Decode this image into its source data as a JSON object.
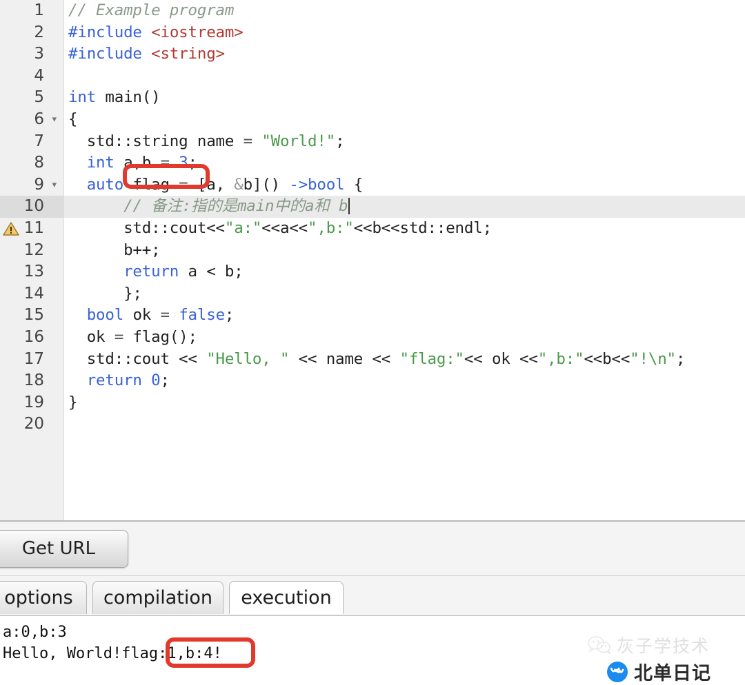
{
  "editor": {
    "active_line": 10,
    "warning_line": 11,
    "fold_lines": [
      6,
      9
    ],
    "caret_line": 10,
    "colors": {
      "comment": "#8a9a8a",
      "keyword": "#3a62d8",
      "include": "#b33a32",
      "string": "#4a9a4a",
      "gutter_bg": "#f0f0f0",
      "active_line_bg": "#eaeaea",
      "annotation_red": "#e1392c"
    },
    "lines": [
      {
        "n": "1",
        "tokens": [
          {
            "t": "// Example program",
            "c": "cmt"
          }
        ]
      },
      {
        "n": "2",
        "tokens": [
          {
            "t": "#include ",
            "c": "pp"
          },
          {
            "t": "<iostream>",
            "c": "inc"
          }
        ]
      },
      {
        "n": "3",
        "tokens": [
          {
            "t": "#include ",
            "c": "pp"
          },
          {
            "t": "<string>",
            "c": "inc"
          }
        ]
      },
      {
        "n": "4",
        "tokens": [
          {
            "t": "",
            "c": "plain"
          }
        ]
      },
      {
        "n": "5",
        "tokens": [
          {
            "t": "int ",
            "c": "kw"
          },
          {
            "t": "main()",
            "c": "plain"
          }
        ]
      },
      {
        "n": "6",
        "tokens": [
          {
            "t": "{",
            "c": "plain"
          }
        ]
      },
      {
        "n": "7",
        "tokens": [
          {
            "t": "  std::string name ",
            "c": "plain"
          },
          {
            "t": "= ",
            "c": "op"
          },
          {
            "t": "\"World!\"",
            "c": "str"
          },
          {
            "t": ";",
            "c": "plain"
          }
        ]
      },
      {
        "n": "8",
        "tokens": [
          {
            "t": "  ",
            "c": "plain"
          },
          {
            "t": "int ",
            "c": "kw"
          },
          {
            "t": "a,b ",
            "c": "plain"
          },
          {
            "t": "= ",
            "c": "op"
          },
          {
            "t": "3",
            "c": "num"
          },
          {
            "t": ";",
            "c": "plain"
          }
        ]
      },
      {
        "n": "9",
        "tokens": [
          {
            "t": "  ",
            "c": "plain"
          },
          {
            "t": "auto ",
            "c": "kw"
          },
          {
            "t": "flag ",
            "c": "plain"
          },
          {
            "t": "= ",
            "c": "op"
          },
          {
            "t": "[a, ",
            "c": "plain"
          },
          {
            "t": "&",
            "c": "amp"
          },
          {
            "t": "b]() ",
            "c": "plain"
          },
          {
            "t": "->bool ",
            "c": "kw"
          },
          {
            "t": "{",
            "c": "plain"
          }
        ]
      },
      {
        "n": "10",
        "tokens": [
          {
            "t": "      ",
            "c": "plain"
          },
          {
            "t": "// 备注:指的是main中的a和 b",
            "c": "cmt"
          }
        ]
      },
      {
        "n": "11",
        "tokens": [
          {
            "t": "      std::cout<<",
            "c": "plain"
          },
          {
            "t": "\"a:\"",
            "c": "str"
          },
          {
            "t": "<<a<<",
            "c": "plain"
          },
          {
            "t": "\",b:\"",
            "c": "str"
          },
          {
            "t": "<<b<<std::endl;",
            "c": "plain"
          }
        ]
      },
      {
        "n": "12",
        "tokens": [
          {
            "t": "      b++;",
            "c": "plain"
          }
        ]
      },
      {
        "n": "13",
        "tokens": [
          {
            "t": "      ",
            "c": "plain"
          },
          {
            "t": "return ",
            "c": "kw"
          },
          {
            "t": "a < b;",
            "c": "plain"
          }
        ]
      },
      {
        "n": "14",
        "tokens": [
          {
            "t": "      };",
            "c": "plain"
          }
        ]
      },
      {
        "n": "15",
        "tokens": [
          {
            "t": "  ",
            "c": "plain"
          },
          {
            "t": "bool ",
            "c": "kw"
          },
          {
            "t": "ok ",
            "c": "plain"
          },
          {
            "t": "= ",
            "c": "op"
          },
          {
            "t": "false",
            "c": "kw"
          },
          {
            "t": ";",
            "c": "plain"
          }
        ]
      },
      {
        "n": "16",
        "tokens": [
          {
            "t": "  ok ",
            "c": "plain"
          },
          {
            "t": "= ",
            "c": "op"
          },
          {
            "t": "flag();",
            "c": "plain"
          }
        ]
      },
      {
        "n": "17",
        "tokens": [
          {
            "t": "  std::cout << ",
            "c": "plain"
          },
          {
            "t": "\"Hello, \"",
            "c": "str"
          },
          {
            "t": " << name << ",
            "c": "plain"
          },
          {
            "t": "\"flag:\"",
            "c": "str"
          },
          {
            "t": "<< ok <<",
            "c": "plain"
          },
          {
            "t": "\",b:\"",
            "c": "str"
          },
          {
            "t": "<<b<<",
            "c": "plain"
          },
          {
            "t": "\"!\\n\"",
            "c": "str"
          },
          {
            "t": ";",
            "c": "plain"
          }
        ]
      },
      {
        "n": "18",
        "tokens": [
          {
            "t": "  ",
            "c": "plain"
          },
          {
            "t": "return ",
            "c": "kw"
          },
          {
            "t": "0",
            "c": "num"
          },
          {
            "t": ";",
            "c": "plain"
          }
        ]
      },
      {
        "n": "19",
        "tokens": [
          {
            "t": "}",
            "c": "plain"
          }
        ]
      },
      {
        "n": "20",
        "tokens": [
          {
            "t": "",
            "c": "plain"
          }
        ]
      }
    ]
  },
  "annotations": {
    "code_highlight_text": "a,b = 3;",
    "output_highlight_text": ":1,b:4!"
  },
  "toolbar": {
    "get_url_label": "Get URL"
  },
  "tabs": [
    {
      "id": "options",
      "label": "options",
      "active": false
    },
    {
      "id": "compilation",
      "label": "compilation",
      "active": false
    },
    {
      "id": "execution",
      "label": "execution",
      "active": true
    }
  ],
  "output": {
    "lines": [
      "a:0,b:3",
      "Hello, World!flag:1,b:4!"
    ]
  },
  "watermarks": {
    "top": "灰子学技术",
    "bottom": "北单日记"
  }
}
